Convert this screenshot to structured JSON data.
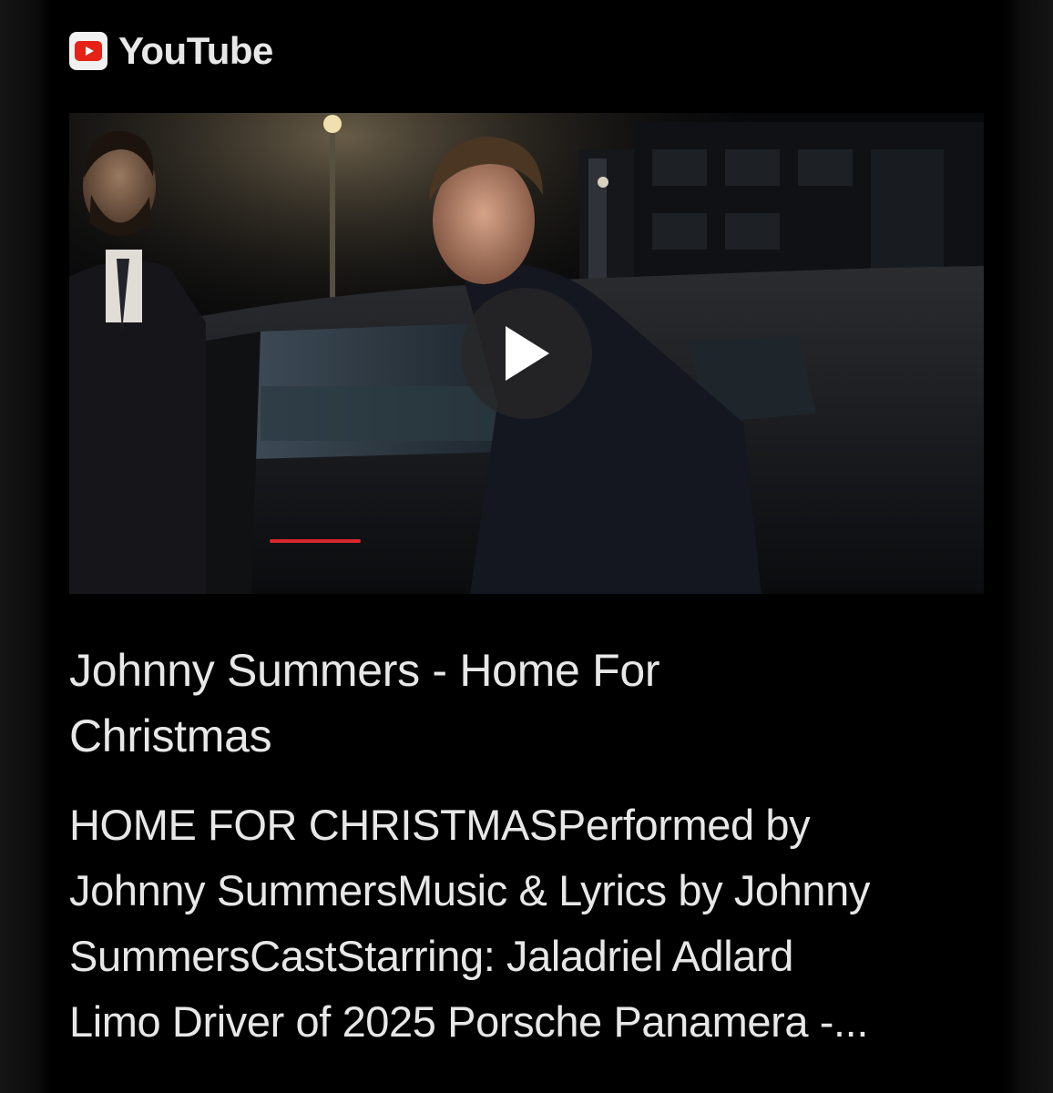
{
  "source": {
    "label": "YouTube",
    "icon": "youtube-icon",
    "icon_color": "#e62117"
  },
  "video": {
    "play_icon": "play-icon",
    "title_lines": [
      "Johnny Summers - Home For",
      "Christmas"
    ],
    "description_lines": [
      "HOME FOR CHRISTMASPerformed by",
      "Johnny SummersMusic & Lyrics by Johnny",
      "SummersCastStarring: Jaladriel Adlard",
      "Limo Driver of 2025 Porsche Panamera -..."
    ]
  }
}
